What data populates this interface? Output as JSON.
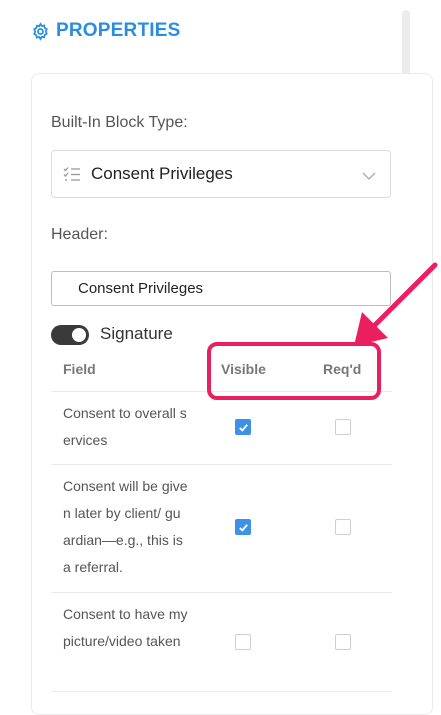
{
  "panel": {
    "title": "PROPERTIES",
    "icon": "gear-icon",
    "accent_color": "#2b8de0"
  },
  "block_type": {
    "label": "Built-In Block Type:",
    "value": "Consent Privileges",
    "icon": "list-icon"
  },
  "header_field": {
    "label": "Header:",
    "value": "Consent Privileges"
  },
  "signature": {
    "label": "Signature",
    "on": true
  },
  "table": {
    "columns": {
      "field": "Field",
      "visible": "Visible",
      "required": "Req'd"
    },
    "rows": [
      {
        "text": "Consent to overall services",
        "visible": true,
        "required": false
      },
      {
        "text": "Consent will be given later by client/ guardian—e.g., this is a referral.",
        "visible": true,
        "required": false
      },
      {
        "text": "Consent to have my picture/video taken",
        "visible": false,
        "required": false
      }
    ]
  },
  "annotation": {
    "color": "#ea1f5f",
    "target": "Visible / Req'd columns"
  }
}
